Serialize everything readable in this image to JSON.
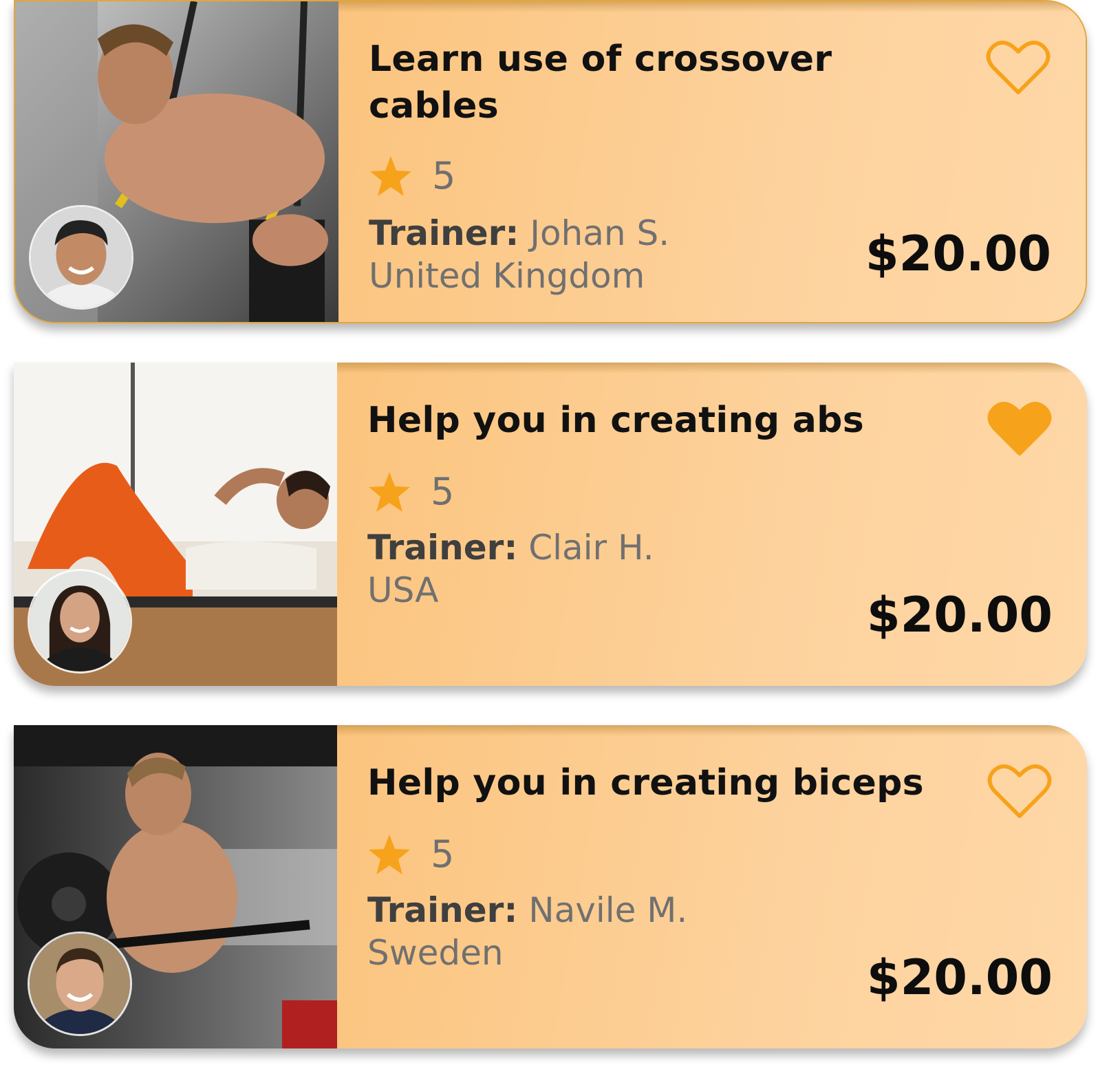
{
  "courses": [
    {
      "title": "Learn use of crossover cables",
      "favorited": false,
      "rating": "5",
      "trainer_label": "Trainer:",
      "trainer_name": "Johan S.",
      "country": "United Kingdom",
      "price": "$20.00"
    },
    {
      "title": "Help you in creating abs",
      "favorited": true,
      "rating": "5",
      "trainer_label": "Trainer:",
      "trainer_name": "Clair H.",
      "country": "USA",
      "price": "$20.00"
    },
    {
      "title": "Help you in creating biceps",
      "favorited": false,
      "rating": "5",
      "trainer_label": "Trainer:",
      "trainer_name": "Navile M.",
      "country": "Sweden",
      "price": "$20.00"
    }
  ],
  "colors": {
    "accent": "#f7a21b",
    "card_bg": "#fdd29d",
    "title": "#111111",
    "muted_text": "#707070"
  },
  "icons": {
    "heart": "heart-icon",
    "star": "star-icon"
  }
}
